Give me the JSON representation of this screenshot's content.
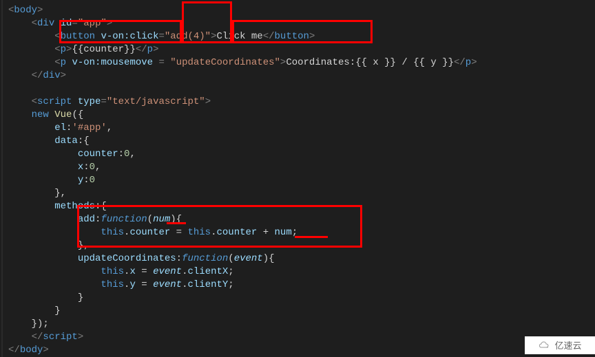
{
  "code": {
    "l1": {
      "open": "<",
      "tag": "body",
      "close": ">"
    },
    "l2": {
      "open": "<",
      "tag": "div",
      "attr": "id",
      "eq": "=",
      "val": "\"app\"",
      "close": ">"
    },
    "l3": {
      "open": "<",
      "tag": "button",
      "attr": "v-on:click",
      "eq": "=",
      "val": "\"add(4)\"",
      "close": ">",
      "text": "Click me",
      "open2": "</",
      "close2": ">"
    },
    "l4": {
      "open": "<",
      "tag": "p",
      "close": ">",
      "text": "{{counter}}",
      "open2": "</",
      "close2": ">"
    },
    "l5": {
      "open": "<",
      "tag": "p",
      "attr": "v-on:mousemove",
      "eq": " = ",
      "val": "\"updateCoordinates\"",
      "close": ">",
      "text": "Coordinates:{{ x }} / {{ y }}",
      "open2": "</",
      "close2": ">"
    },
    "l6": {
      "open": "</",
      "tag": "div",
      "close": ">"
    },
    "l8": {
      "open": "<",
      "tag": "script",
      "attr": "type",
      "eq": "=",
      "val": "\"text/javascript\"",
      "close": ">"
    },
    "l9_new": "new ",
    "l9_vue": "Vue",
    "l9_rest": "({",
    "l10_key": "el",
    "l10_colon": ":",
    "l10_val": "'#app'",
    "l10_comma": ",",
    "l11_key": "data",
    "l11_rest": ":{",
    "l12_key": "counter",
    "l12_colon": ":",
    "l12_val": "0",
    "l12_comma": ",",
    "l13_key": "x",
    "l13_colon": ":",
    "l13_val": "0",
    "l13_comma": ",",
    "l14_key": "y",
    "l14_colon": ":",
    "l14_val": "0",
    "l15": "},",
    "l16_key": "methods",
    "l16_rest": ":{",
    "l17_key": "add",
    "l17_colon": ":",
    "l17_fn": "function",
    "l17_p1": "(",
    "l17_param": "num",
    "l17_p2": "){",
    "l18_this": "this",
    "l18_dot1": ".",
    "l18_counter": "counter",
    "l18_eq": " = ",
    "l18_this2": "this",
    "l18_dot2": ".",
    "l18_counter2": "counter",
    "l18_plus": " + ",
    "l18_num": "num",
    "l18_semi": ";",
    "l19": "},",
    "l20_key": "updateCoordinates",
    "l20_colon": ":",
    "l20_fn": "function",
    "l20_p1": "(",
    "l20_param": "event",
    "l20_p2": "){",
    "l21_this": "this",
    "l21_dot": ".",
    "l21_x": "x",
    "l21_eq": " = ",
    "l21_ev": "event",
    "l21_dot2": ".",
    "l21_cx": "clientX",
    "l21_semi": ";",
    "l22_this": "this",
    "l22_dot": ".",
    "l22_y": "y",
    "l22_eq": " = ",
    "l22_ev": "event",
    "l22_dot2": ".",
    "l22_cy": "clientY",
    "l22_semi": ";",
    "l23": "}",
    "l24": "}",
    "l25": "});",
    "l26": {
      "open": "</",
      "tag": "script",
      "close": ">"
    },
    "l27": {
      "open": "</",
      "tag": "body",
      "close": ">"
    }
  },
  "watermark": "亿速云"
}
